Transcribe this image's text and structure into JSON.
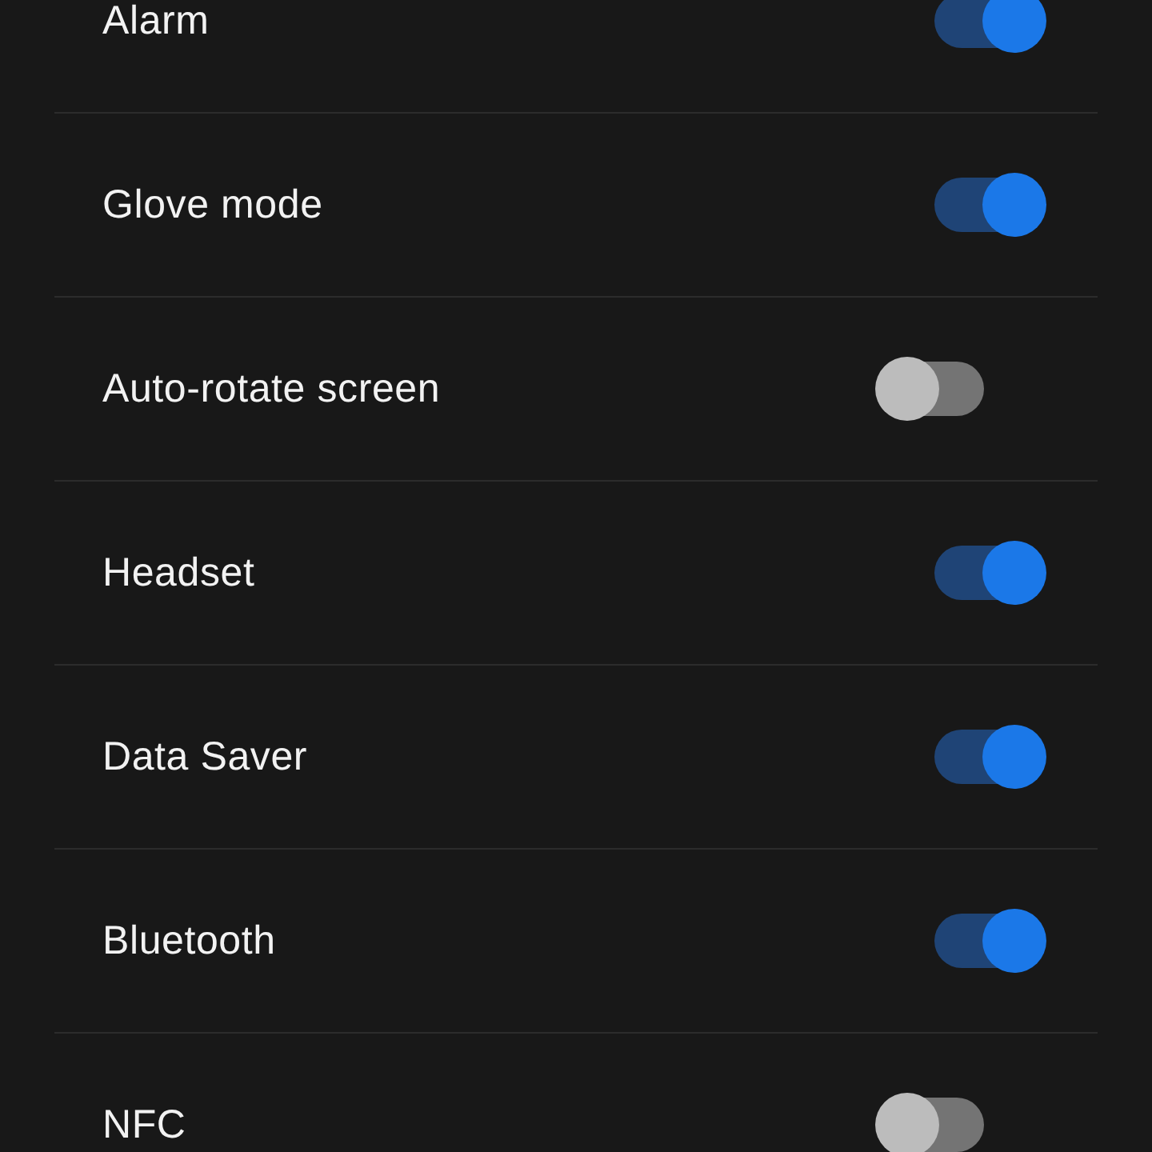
{
  "settings": [
    {
      "label": "Alarm",
      "on": true
    },
    {
      "label": "Glove mode",
      "on": true
    },
    {
      "label": "Auto-rotate screen",
      "on": false
    },
    {
      "label": "Headset",
      "on": true
    },
    {
      "label": "Data Saver",
      "on": true
    },
    {
      "label": "Bluetooth",
      "on": true
    },
    {
      "label": "NFC",
      "on": false
    }
  ]
}
